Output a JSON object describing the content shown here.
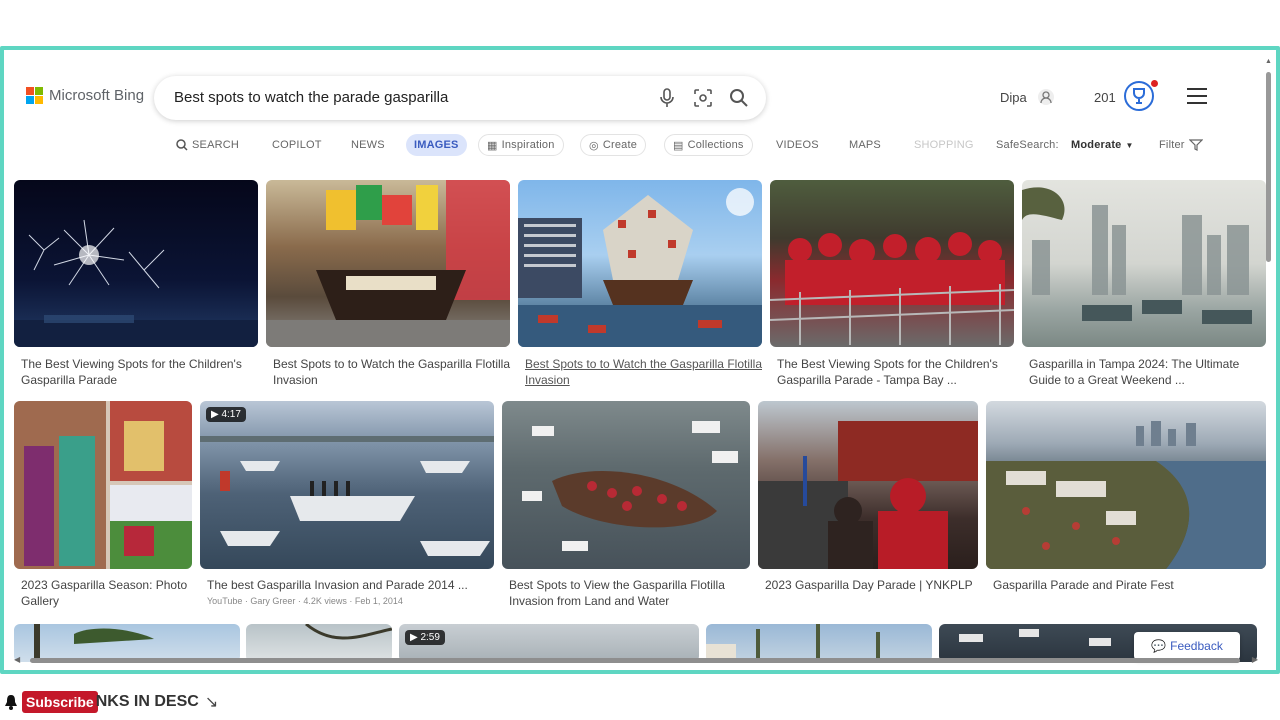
{
  "brand": {
    "name": "Microsoft Bing",
    "logo_colors": [
      "#f25022",
      "#7fba00",
      "#00a4ef",
      "#ffb900"
    ]
  },
  "search": {
    "query": "Best spots to watch the parade gasparilla"
  },
  "user": {
    "name": "Dipa",
    "points": "201"
  },
  "nav": {
    "search": "SEARCH",
    "copilot": "COPILOT",
    "news": "NEWS",
    "images": "IMAGES",
    "inspiration": "Inspiration",
    "create": "Create",
    "collections": "Collections",
    "videos": "VIDEOS",
    "maps": "MAPS",
    "shopping": "SHOPPING",
    "safesearch": "SafeSearch:",
    "safesearch_value": "Moderate",
    "filter": "Filter"
  },
  "images": [
    {
      "caption": "The Best Viewing Spots for the Children's Gasparilla Parade",
      "colors": [
        "#0a0d26",
        "#1b2a5a"
      ]
    },
    {
      "caption": "Best Spots to to Watch the Gasparilla Flotilla Invasion",
      "colors": [
        "#7c5a3c",
        "#c94f3a"
      ]
    },
    {
      "caption": "Best Spots to to Watch the Gasparilla Flotilla Invasion",
      "colors": [
        "#6fa3d8",
        "#c0392b"
      ]
    },
    {
      "caption": "The Best Viewing Spots for the Children's Gasparilla Parade - Tampa Bay ...",
      "colors": [
        "#3f3a2e",
        "#b9232c"
      ]
    },
    {
      "caption": "Gasparilla in Tampa 2024: The Ultimate Guide to a Great Weekend ...",
      "colors": [
        "#c8c9c4",
        "#7f8f8a"
      ]
    },
    {
      "caption": "2023 Gasparilla Season: Photo Gallery",
      "colors": [
        "#a7524c",
        "#3d8a54"
      ]
    },
    {
      "caption": "The best Gasparilla Invasion and Parade 2014 ...",
      "source": "YouTube · Gary Greer · 4.2K views · Feb 1, 2014",
      "duration": "4:17",
      "colors": [
        "#5a6e86",
        "#2e3b4a"
      ]
    },
    {
      "caption": "Best Spots to View the Gasparilla Flotilla Invasion from Land and Water",
      "colors": [
        "#6b7a7e",
        "#3b2e28"
      ]
    },
    {
      "caption": "2023 Gasparilla Day Parade | YNKPLP",
      "colors": [
        "#54443a",
        "#b3202a"
      ]
    },
    {
      "caption": "Gasparilla Parade and Pirate Fest",
      "colors": [
        "#6e7c8c",
        "#4f5a3f"
      ]
    }
  ],
  "third_row_duration": "2:59",
  "feedback": "Feedback",
  "subscribe": {
    "button": "Subscribe",
    "rest": "NKS IN DESC"
  }
}
